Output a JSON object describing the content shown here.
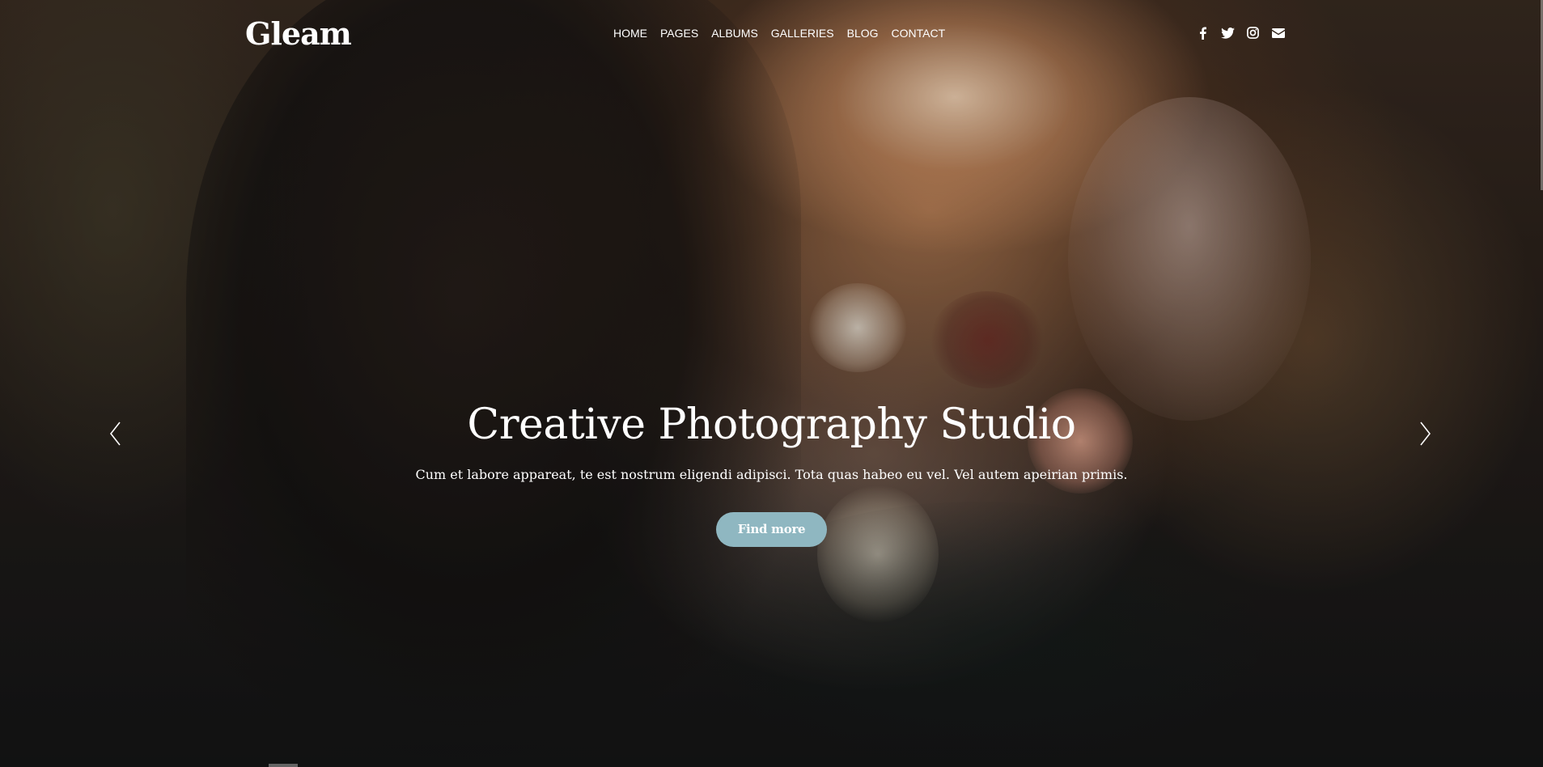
{
  "header": {
    "logo": "Gleam",
    "nav": [
      "HOME",
      "PAGES",
      "ALBUMS",
      "GALLERIES",
      "BLOG",
      "CONTACT"
    ],
    "social_icons": [
      "facebook-icon",
      "twitter-icon",
      "instagram-icon",
      "envelope-icon"
    ]
  },
  "hero": {
    "title": "Creative Photography Studio",
    "subtitle": "Cum et labore appareat, te est nostrum eligendi adipisci. Tota quas habeo eu vel. Vel autem apeirian primis.",
    "button_label": "Find more",
    "prev_icon": "chevron-left-icon",
    "next_icon": "chevron-right-icon"
  },
  "colors": {
    "button": "#8fb7c1",
    "text": "#ffffff"
  }
}
